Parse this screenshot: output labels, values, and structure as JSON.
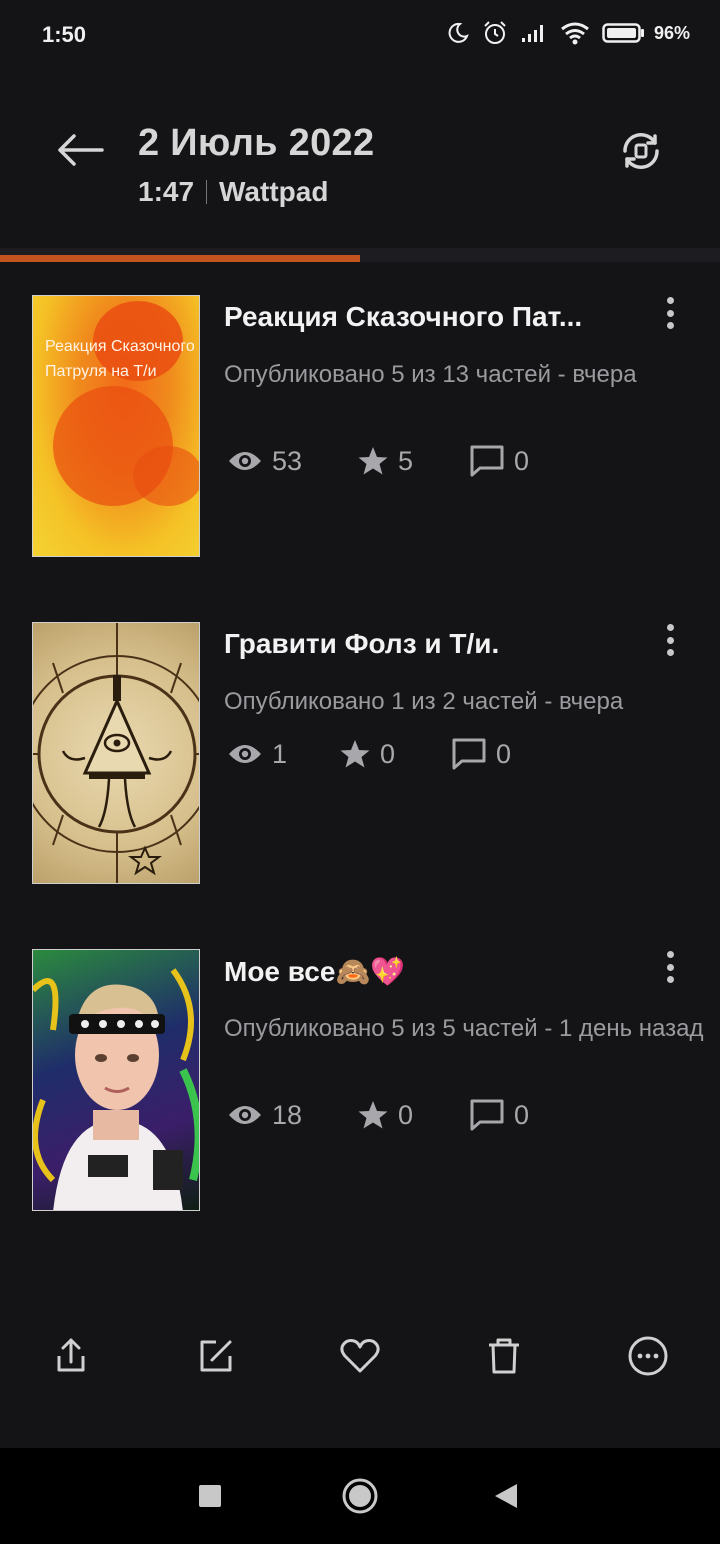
{
  "status_bar": {
    "time": "1:50",
    "battery": "96%"
  },
  "header": {
    "title": "2 Июль 2022",
    "time": "1:47",
    "app": "Wattpad"
  },
  "progress": {
    "fraction": 0.5,
    "color": "#c4541f"
  },
  "stories": [
    {
      "title": "Реакция Сказочного Пат...",
      "cover_text": "Реакция Сказочного Патруля на Т/и",
      "meta": "Опубликовано 5 из 13 частей - вчера",
      "views": "53",
      "votes": "5",
      "comments": "0"
    },
    {
      "title": "Гравити Фолз и Т/и.",
      "meta": "Опубликовано 1 из 2 частей - вчера",
      "views": "1",
      "votes": "0",
      "comments": "0"
    },
    {
      "title": "Мое все🙈💖",
      "meta": "Опубликовано 5 из 5 частей - 1 день назад",
      "views": "18",
      "votes": "0",
      "comments": "0"
    }
  ],
  "toolbar": {
    "icons": [
      "share-icon",
      "edit-icon",
      "heart-icon",
      "trash-icon",
      "more-icon"
    ]
  },
  "navbar": {
    "icons": [
      "recents-icon",
      "home-icon",
      "back-icon"
    ]
  },
  "colors": {
    "background": "#141316",
    "accent": "#c4541f",
    "text_primary": "#f2f2f2",
    "text_secondary": "#9b9b9f"
  }
}
